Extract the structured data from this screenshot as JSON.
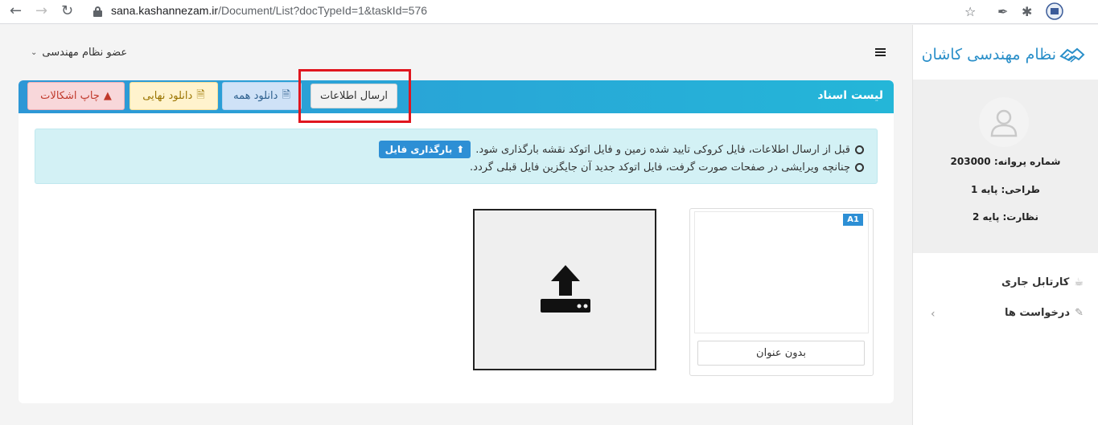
{
  "browser": {
    "url_host": "sana.kashannezam.ir",
    "url_path": "/Document/List?docTypeId=1&taskId=576"
  },
  "sidebar": {
    "brand": "نظام مهندسی کاشان",
    "license": "شماره پروانه: 203000",
    "design": "طراحی: پایه 1",
    "supervision": "نظارت: پایه 2",
    "menu": [
      {
        "label": "کارتابل جاری",
        "icon": "mug-icon"
      },
      {
        "label": "درخواست ها",
        "icon": "edit-icon"
      }
    ]
  },
  "header": {
    "member_role": "عضو نظام مهندسی"
  },
  "card": {
    "title": "لیست اسناد",
    "buttons": {
      "print_issues": "چاپ اشکالات",
      "final_download": "دانلود نهایی",
      "download_all": "دانلود همه",
      "send_info": "ارسال اطلاعات"
    },
    "alert": {
      "line1": "قبل از ارسال اطلاعات، فایل کروکی تایید شده زمین و فایل اتوکد نقشه بارگذاری شود.",
      "upload_label": "بارگذاری فایل",
      "line2": "چنانچه ویرایشی در صفحات صورت گرفت، فایل اتوکد جدید آن جایگزین فایل قبلی گردد."
    },
    "document": {
      "badge": "A1",
      "title": "بدون عنوان"
    }
  },
  "colors": {
    "header_gradient_start": "#2d97d6",
    "header_gradient_end": "#24b6d8",
    "highlight_box": "#e0161f",
    "brand": "#2a8fc9"
  }
}
